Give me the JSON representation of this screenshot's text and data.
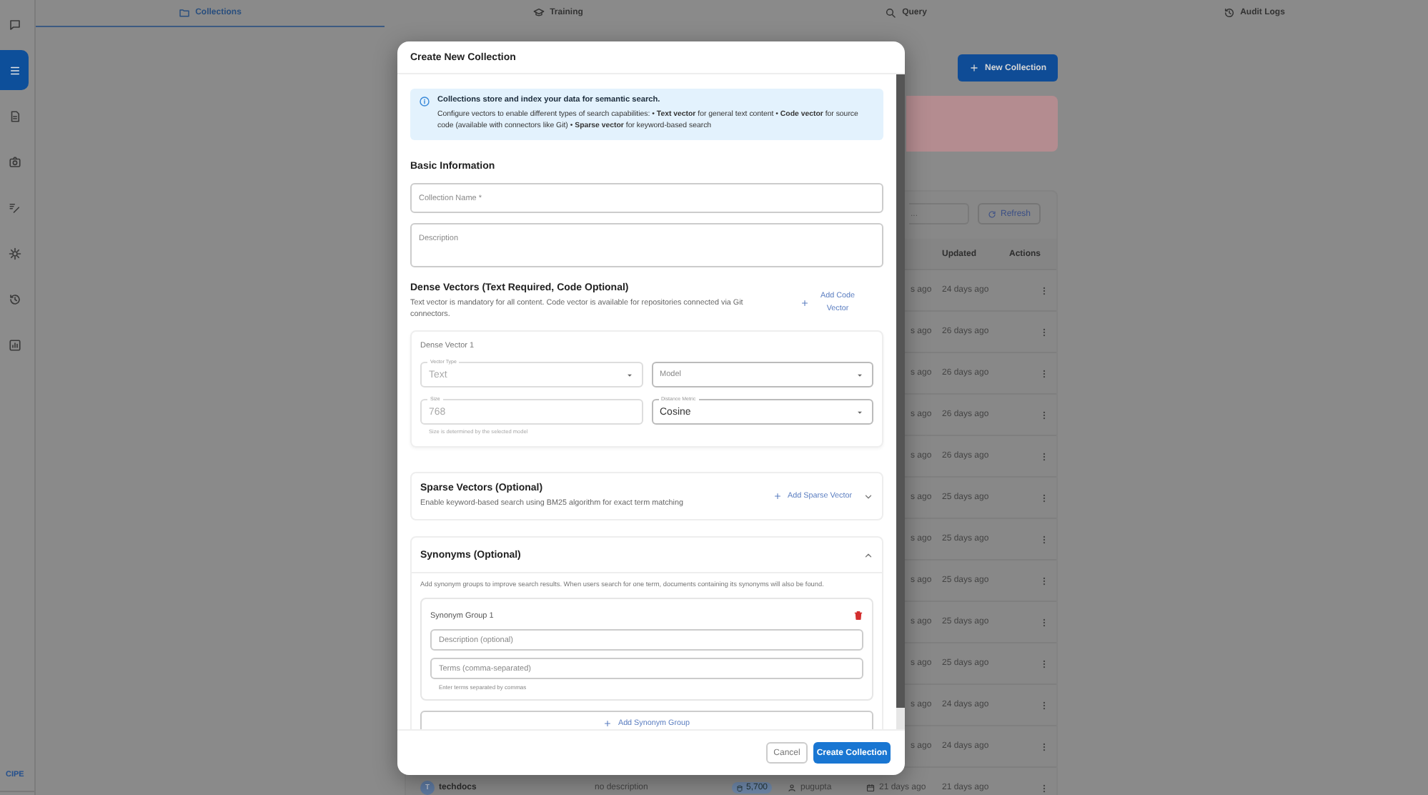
{
  "sidebar": {
    "items": [
      {
        "selected": false
      },
      {
        "selected": true
      },
      {
        "selected": false
      },
      {
        "selected": false
      },
      {
        "selected": false
      },
      {
        "selected": false
      },
      {
        "selected": false
      },
      {
        "selected": false
      }
    ],
    "brand": "CIPE"
  },
  "tabs": [
    {
      "label": "Collections",
      "selected": true
    },
    {
      "label": "Training",
      "selected": false
    },
    {
      "label": "Query",
      "selected": false
    },
    {
      "label": "Audit Logs",
      "selected": false
    }
  ],
  "page": {
    "new_button": "New Collection",
    "search": {
      "placeholder": "..."
    },
    "refresh_button": "Refresh",
    "columns": [
      "Updated",
      "Actions"
    ],
    "rows": [
      {
        "created": "s ago",
        "updated": "24 days ago"
      },
      {
        "created": "s ago",
        "updated": "26 days ago"
      },
      {
        "created": "s ago",
        "updated": "26 days ago"
      },
      {
        "created": "s ago",
        "updated": "26 days ago"
      },
      {
        "created": "s ago",
        "updated": "26 days ago"
      },
      {
        "created": "s ago",
        "updated": "25 days ago"
      },
      {
        "created": "s ago",
        "updated": "25 days ago"
      },
      {
        "created": "s ago",
        "updated": "25 days ago"
      },
      {
        "created": "s ago",
        "updated": "25 days ago"
      },
      {
        "created": "s ago",
        "updated": "25 days ago"
      },
      {
        "created": "s ago",
        "updated": "24 days ago"
      },
      {
        "created": "s ago",
        "updated": "24 days ago"
      }
    ],
    "last_row": {
      "avatar": "T",
      "name": "techdocs",
      "description": "no description",
      "count": "5,700",
      "owner": "pugupta",
      "created": "21 days ago",
      "updated": "21 days ago"
    }
  },
  "modal": {
    "title": "Create New Collection",
    "info": {
      "title": "Collections store and index your data for semantic search.",
      "text": "Configure vectors to enable different types of search capabilities: • **Text vector** for general text content • **Code vector** for source code (available with connectors like Git) • **Sparse vector** for keyword-based search"
    },
    "basic": {
      "heading": "Basic Information",
      "name_field": {
        "placeholder": "Collection Name *"
      },
      "description_field": {
        "placeholder": "Description"
      }
    },
    "dense": {
      "heading": "Dense Vectors (Text Required, Code Optional)",
      "text": "Text vector is mandatory for all content. Code vector is available for repositories connected via Git connectors.",
      "add_button": "Add Code Vector",
      "vectors": [
        {
          "title": "Dense Vector 1",
          "vector_type": {
            "label": "Vector Type",
            "value": "Text",
            "disabled": true
          },
          "model": {
            "placeholder": "Model"
          },
          "size": {
            "label": "Size",
            "value": "768",
            "disabled": true,
            "helper": "Size is determined by the selected model"
          },
          "distance": {
            "label": "Distance Metric",
            "value": "Cosine"
          }
        }
      ]
    },
    "sparse": {
      "heading": "Sparse Vectors (Optional)",
      "text": "Enable keyword-based search using BM25 algorithm for exact term matching",
      "add_button": "Add Sparse Vector",
      "expanded": false
    },
    "synonyms": {
      "heading": "Synonyms (Optional)",
      "expanded": true,
      "text": "Add synonym groups to improve search results. When users search for one term, documents containing its synonyms will also be found.",
      "groups": [
        {
          "title": "Synonym Group 1",
          "description": {
            "placeholder": "Description (optional)"
          },
          "terms": {
            "placeholder": "Terms (comma-separated)",
            "helper": "Enter terms separated by commas"
          }
        }
      ],
      "add_button": "Add Synonym Group"
    },
    "cancel_button": "Cancel",
    "create_button": "Create Collection"
  }
}
